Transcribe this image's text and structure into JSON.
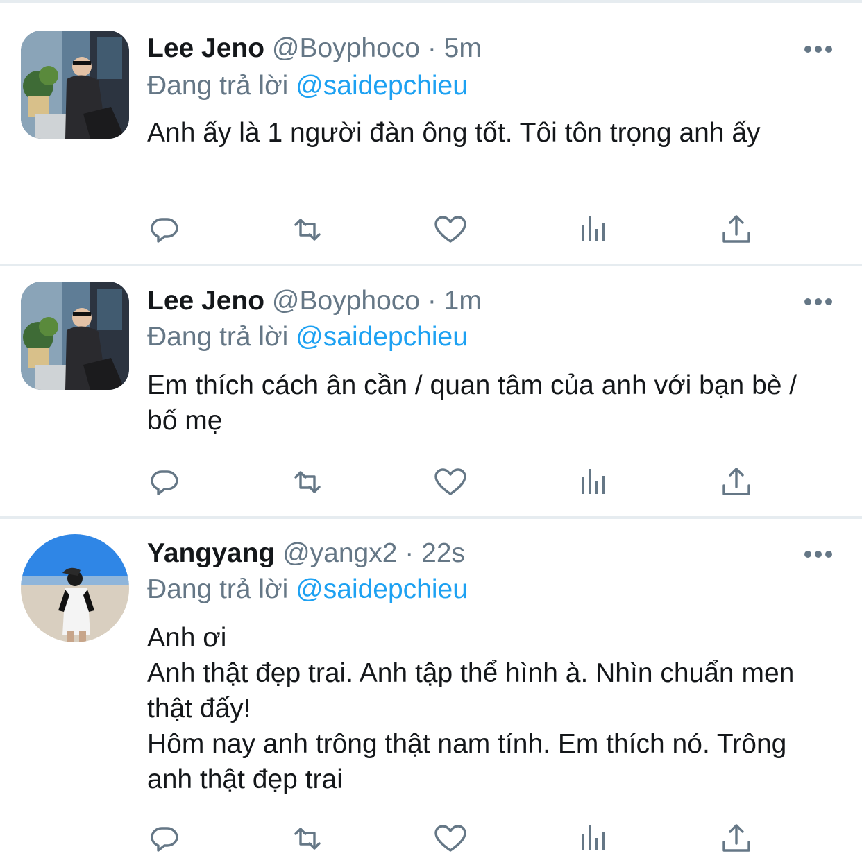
{
  "tweets": [
    {
      "name": "Lee Jeno",
      "handle": "@Boyphoco",
      "separator": "·",
      "time": "5m",
      "reply_prefix": "Đang trả lời",
      "reply_to": "@saidepchieu",
      "text": "Anh ấy là 1 người đàn ông tốt. Tôi tôn trọng anh ấy",
      "avatar_icon": "user-photo-street"
    },
    {
      "name": "Lee Jeno",
      "handle": "@Boyphoco",
      "separator": "·",
      "time": "1m",
      "reply_prefix": "Đang trả lời",
      "reply_to": "@saidepchieu",
      "text": "Em thích cách ân cần / quan tâm của anh với bạn bè / bố mẹ",
      "avatar_icon": "user-photo-street"
    },
    {
      "name": "Yangyang",
      "handle": "@yangx2",
      "separator": "·",
      "time": "22s",
      "reply_prefix": "Đang trả lời",
      "reply_to": "@saidepchieu",
      "text": "Anh ơi\nAnh thật đẹp trai. Anh tập thể hình à. Nhìn chuẩn men thật đấy!\nHôm nay anh trông thật nam tính. Em thích nó. Trông anh thật đẹp trai",
      "avatar_icon": "user-photo-beach"
    }
  ],
  "actions": [
    "reply-icon",
    "retweet-icon",
    "like-icon",
    "analytics-icon",
    "share-icon"
  ],
  "colors": {
    "text": "#14171a",
    "secondary": "#657786",
    "accent": "#1da1f2",
    "divider": "#e6ecf0",
    "icon": "#657786"
  }
}
